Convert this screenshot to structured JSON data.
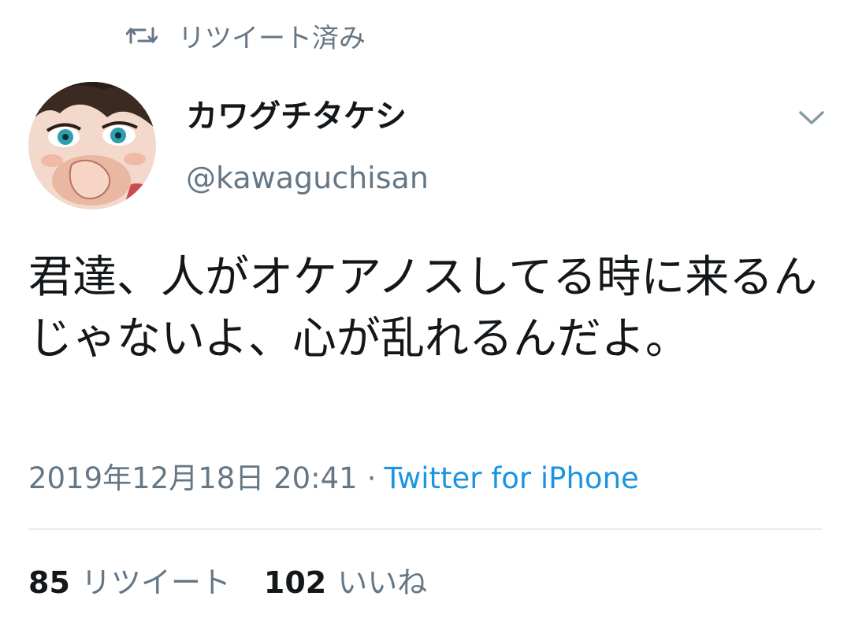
{
  "retweet_banner": {
    "icon": "retweet-icon",
    "label": "リツイート済み"
  },
  "author": {
    "avatar": "avatar-illustration",
    "display_name": "カワグチタケシ",
    "handle": "@kawaguchisan"
  },
  "menu": {
    "icon": "chevron-down-icon"
  },
  "tweet": {
    "text": "君達、人がオケアノスしてる時に来るんじゃないよ、心が乱れるんだよ。"
  },
  "meta": {
    "timestamp": "2019年12月18日 20:41",
    "separator": "·",
    "source": "Twitter for iPhone"
  },
  "stats": {
    "retweets": {
      "count": "85",
      "label": "リツイート"
    },
    "likes": {
      "count": "102",
      "label": "いいね"
    }
  },
  "colors": {
    "text": "#14171a",
    "secondary": "#657786",
    "link": "#1b95e0",
    "divider": "#e6ecf0"
  }
}
